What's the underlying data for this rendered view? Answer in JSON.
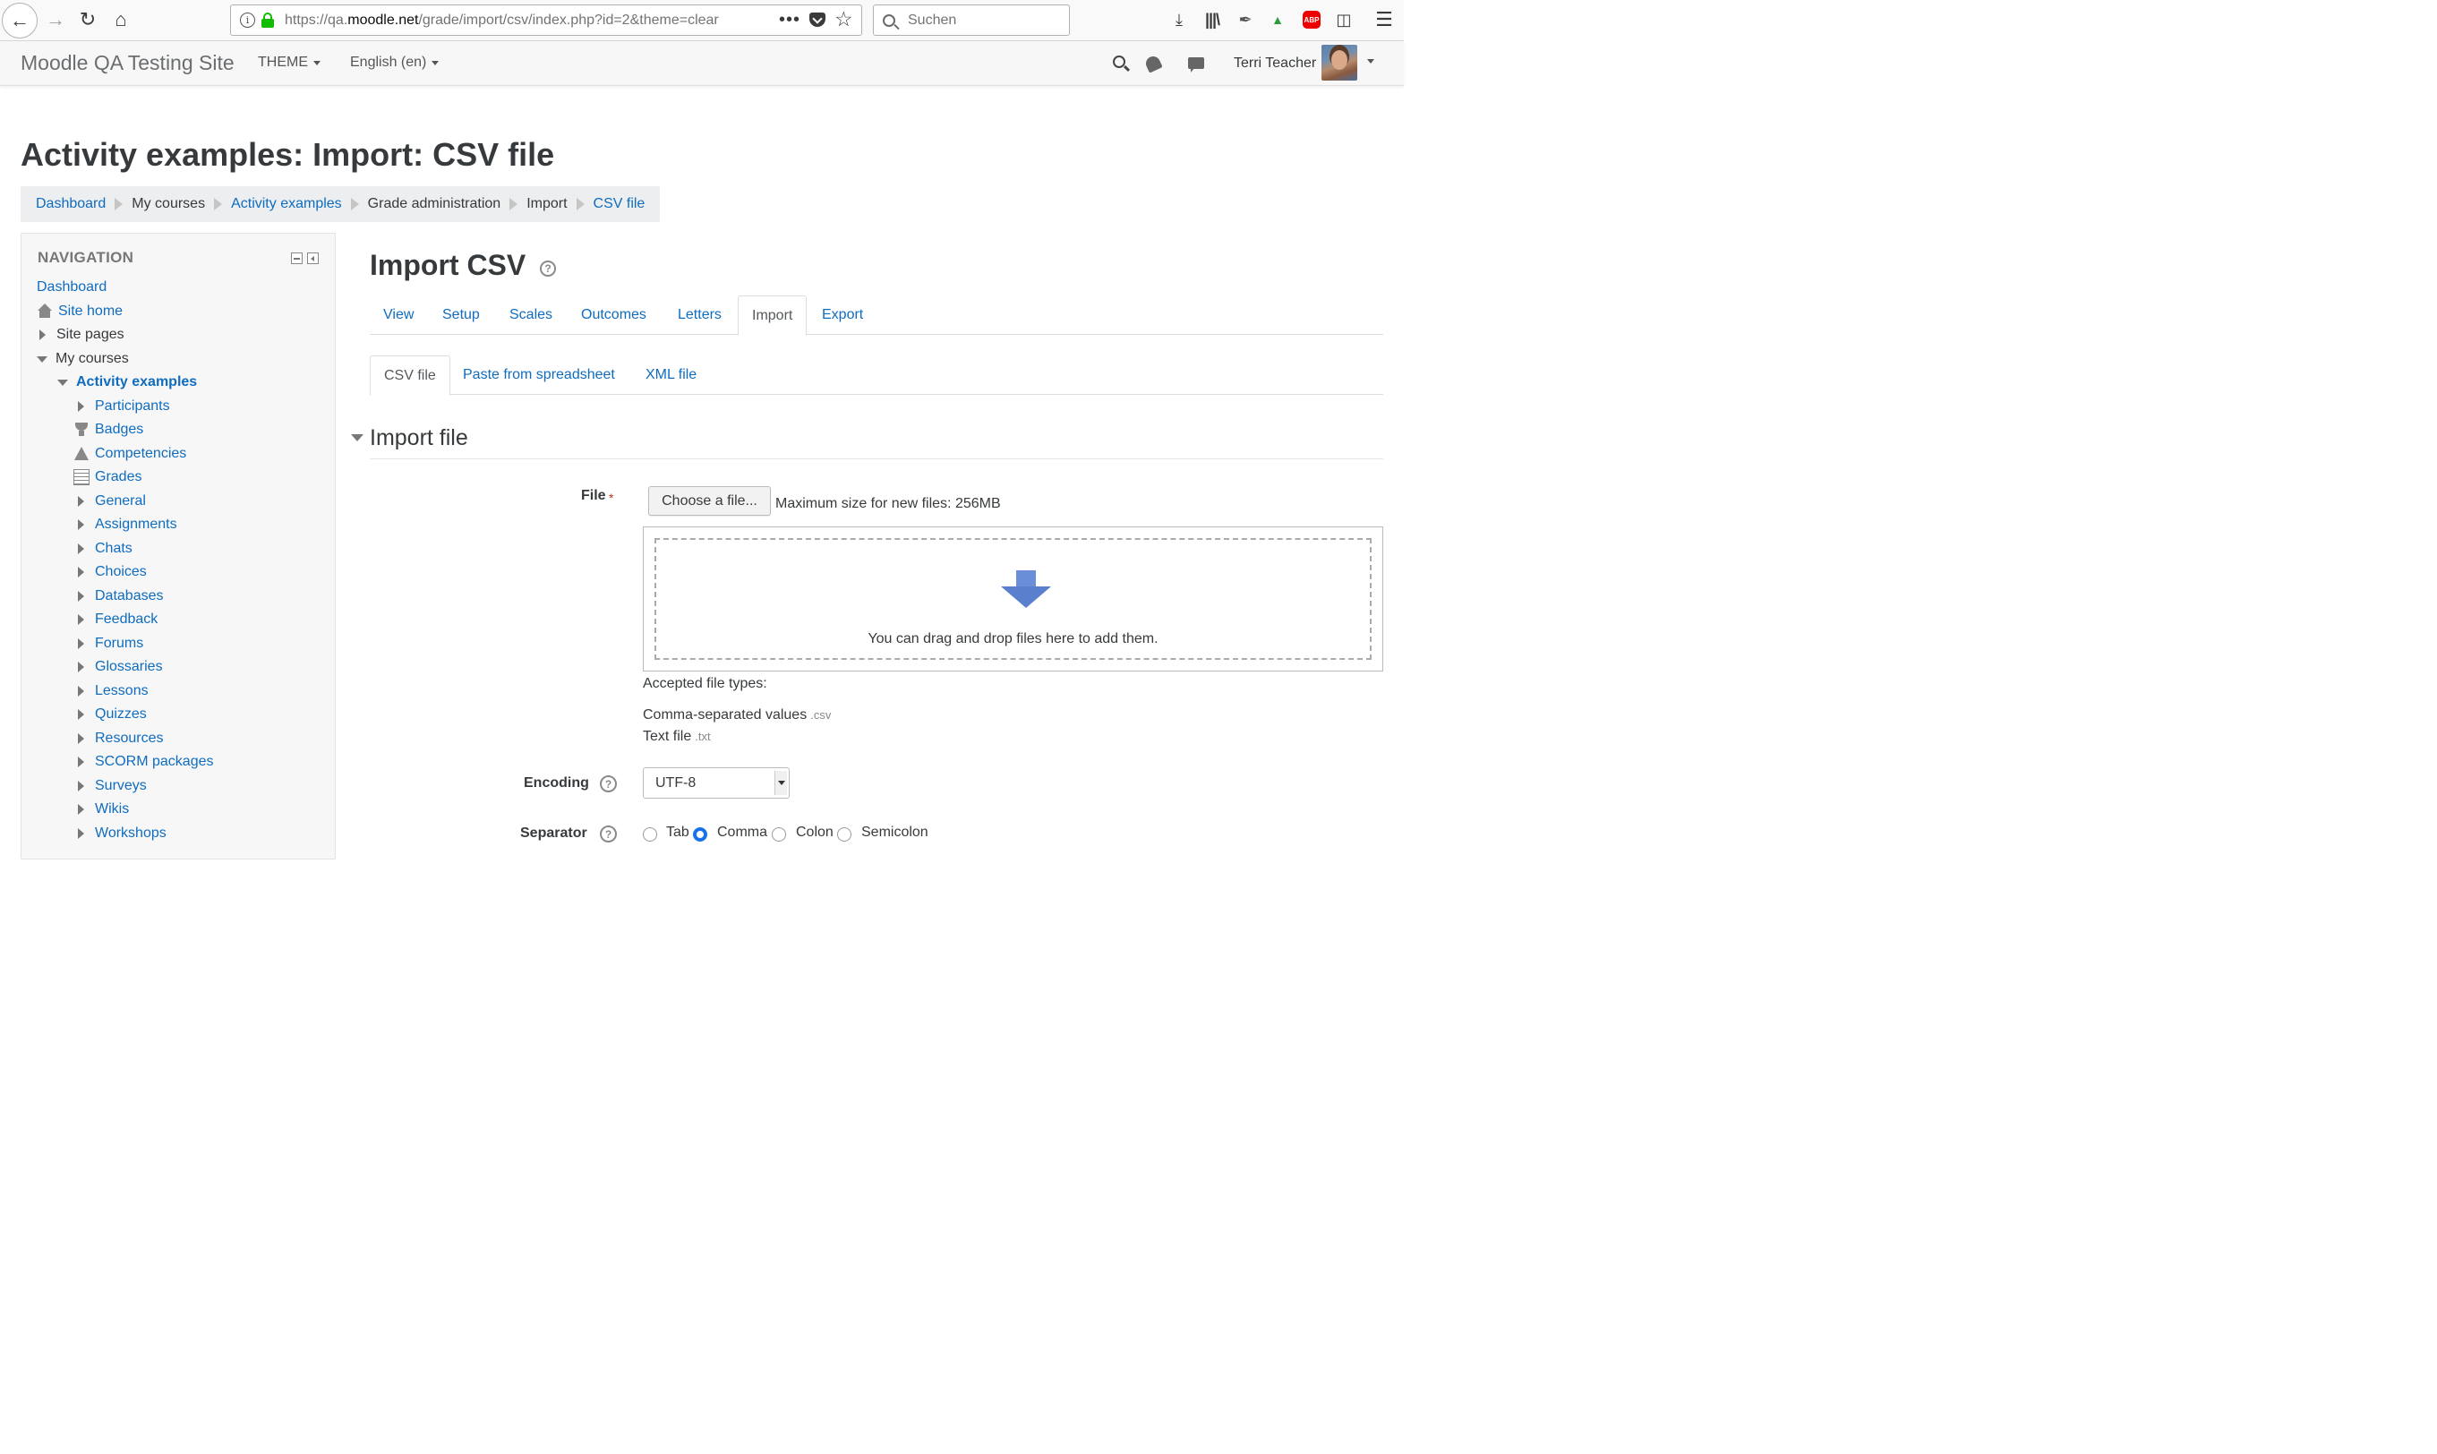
{
  "browser": {
    "url_prefix": "https://qa.",
    "url_domain": "moodle.net",
    "url_path": "/grade/import/csv/index.php?id=2&theme=clear",
    "url_more": "•••",
    "search_placeholder": "Suchen",
    "abp_label": "ABP"
  },
  "navbar": {
    "site_name": "Moodle QA Testing Site",
    "theme_menu": "THEME",
    "language_menu": "English (en)",
    "user_name": "Terri Teacher"
  },
  "page": {
    "title": "Activity examples: Import: CSV file"
  },
  "breadcrumb": [
    {
      "label": "Dashboard",
      "link": true
    },
    {
      "label": "My courses",
      "link": false
    },
    {
      "label": "Activity examples",
      "link": true
    },
    {
      "label": "Grade administration",
      "link": false
    },
    {
      "label": "Import",
      "link": false
    },
    {
      "label": "CSV file",
      "link": true
    }
  ],
  "navigation": {
    "title": "NAVIGATION",
    "items": [
      {
        "label": "Dashboard"
      },
      {
        "label": "Site home"
      },
      {
        "label": "Site pages"
      },
      {
        "label": "My courses"
      },
      {
        "label": "Activity examples"
      },
      {
        "label": "Participants"
      },
      {
        "label": "Badges"
      },
      {
        "label": "Competencies"
      },
      {
        "label": "Grades"
      },
      {
        "label": "General"
      },
      {
        "label": "Assignments"
      },
      {
        "label": "Chats"
      },
      {
        "label": "Choices"
      },
      {
        "label": "Databases"
      },
      {
        "label": "Feedback"
      },
      {
        "label": "Forums"
      },
      {
        "label": "Glossaries"
      },
      {
        "label": "Lessons"
      },
      {
        "label": "Quizzes"
      },
      {
        "label": "Resources"
      },
      {
        "label": "SCORM packages"
      },
      {
        "label": "Surveys"
      },
      {
        "label": "Wikis"
      },
      {
        "label": "Workshops"
      }
    ]
  },
  "main": {
    "title": "Import CSV",
    "tabs": [
      "View",
      "Setup",
      "Scales",
      "Outcomes",
      "Letters",
      "Import",
      "Export"
    ],
    "active_tab": "Import",
    "subtabs": [
      "CSV file",
      "Paste from spreadsheet",
      "XML file"
    ],
    "active_subtab": "CSV file"
  },
  "form": {
    "section_title": "Import file",
    "file_label": "File",
    "required_mark": "*",
    "choose_button": "Choose a file...",
    "max_size": "Maximum size for new files: 256MB",
    "drop_text": "You can drag and drop files here to add them.",
    "accepted_label": "Accepted file types:",
    "file_types": [
      {
        "name": "Comma-separated values",
        "ext": ".csv"
      },
      {
        "name": "Text file",
        "ext": ".txt"
      }
    ],
    "encoding_label": "Encoding",
    "encoding_value": "UTF-8",
    "separator_label": "Separator",
    "separator_options": [
      "Tab",
      "Comma",
      "Colon",
      "Semicolon"
    ],
    "separator_selected": "Comma"
  },
  "colors": {
    "link": "#0f6cbf",
    "text": "#373a3c",
    "required": "#ca3120",
    "radio_checked": "#1a73e8"
  }
}
